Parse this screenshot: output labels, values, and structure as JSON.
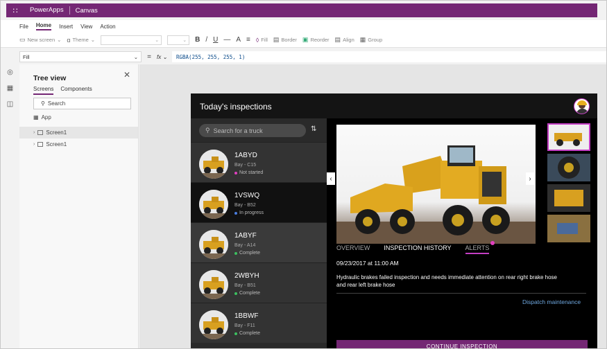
{
  "titlebar": {
    "app_name": "PowerApps",
    "app_sub": "Canvas"
  },
  "menu": {
    "items": [
      "File",
      "Home",
      "Insert",
      "View",
      "Action"
    ],
    "active": "Home"
  },
  "ribbon": {
    "new_screen": "New screen",
    "theme": "Theme",
    "bold": "B",
    "italic": "/",
    "underline": "U",
    "strike": "—",
    "font_size": "A",
    "fill": "Fill",
    "border": "Border",
    "reorder": "Reorder",
    "align": "Align",
    "group": "Group"
  },
  "formula": {
    "property": "Fill",
    "equals": "=",
    "fx": "fx",
    "value": "RGBA(255, 255, 255, 1)"
  },
  "tree": {
    "title": "Tree view",
    "tabs": [
      "Screens",
      "Components"
    ],
    "search_placeholder": "Search",
    "app_label": "App",
    "screens": [
      "Screen1",
      "Screen1"
    ]
  },
  "app": {
    "title": "Today's inspections",
    "search_placeholder": "Search for a truck",
    "trucks": [
      {
        "id": "1ABYD",
        "bay": "Bay - C15",
        "status": "Not started",
        "status_color": "#e040c0"
      },
      {
        "id": "1VSWQ",
        "bay": "Bay - B52",
        "status": "In progress",
        "status_color": "#4a7ee0"
      },
      {
        "id": "1ABYF",
        "bay": "Bay - A14",
        "status": "Complete",
        "status_color": "#3cc060"
      },
      {
        "id": "2WBYH",
        "bay": "Bay - B51",
        "status": "Complete",
        "status_color": "#3cc060"
      },
      {
        "id": "1BBWF",
        "bay": "Bay - F11",
        "status": "Complete",
        "status_color": "#3cc060"
      }
    ],
    "tabs": [
      "OVERVIEW",
      "INSPECTION HISTORY",
      "ALERTS"
    ],
    "active_tab": "ALERTS",
    "alert_time": "09/23/2017 at 11:00 AM",
    "alert_text": "Hydraulic brakes failed inspection and needs immediate attention on rear right brake hose and rear left brake hose",
    "dispatch": "Dispatch maintenance",
    "continue": "CONTINUE INSPECTION"
  },
  "colors": {
    "brand": "#742774",
    "accent": "#c43ec4",
    "link": "#6fa8e0"
  }
}
